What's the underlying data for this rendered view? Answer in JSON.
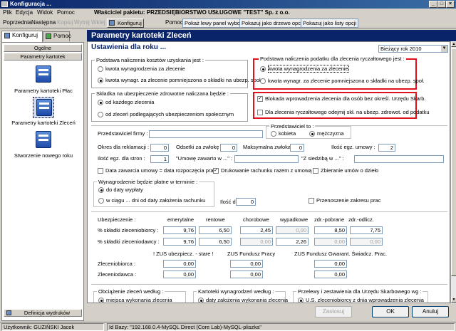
{
  "window": {
    "title": "Konfiguracja ..."
  },
  "menu": [
    "Plik",
    "Edycja",
    "Widok",
    "Pomoc"
  ],
  "owner": "Właściciel pakietu: PRZEDSIĘBIORSTWO USŁUGOWE \"TEST\" Sp. z o.o.",
  "toolbar": {
    "prev": "Poprzednia",
    "next": "Następna",
    "copy": "Kopiuj",
    "cut": "Wytnij",
    "paste": "Wklej",
    "configure": "Konfiguruj",
    "help": "Pomoc:",
    "show_left": "Pokaż lewy panel wyboru",
    "show_tree": "Pokazuj jako drzewo opcji",
    "show_list": "Pokazuj jako listy opcji"
  },
  "tabs": {
    "configure": "Konfiguruj",
    "help": "Pomoc"
  },
  "left": {
    "general": "Ogólne",
    "params": "Parametry kartotek",
    "items": [
      "Parametry kartoteki Płac",
      "Parametry kartoteki Zleceń",
      "Stworzenie nowego roku"
    ],
    "print_defs": "Definicja wydruków"
  },
  "main": {
    "header": "Parametry kartoteki Zleceń",
    "subheader": "Ustawienia dla roku ...",
    "year": "Bieżący rok 2010",
    "g1": {
      "title": "Podstawa naliczenia kosztów uzyskania jest :",
      "o1": "kwota wynagrodzenia za zlecenie",
      "o2": "kwota wynagr. za zlecenie pomniejszona o składki na ubezp. społ."
    },
    "g2": {
      "title": "Podstawa naliczenia podatku dla zlecenia ryczałtowego jest :",
      "o1": "kwota wynagrodzenia za zlecenie",
      "o2": "kwota wynagr. za zlecenie pomniejszona o składki na ubezp. społ."
    },
    "g3": {
      "title": "Składka na ubezpieczenie zdrowotne naliczana będzie :",
      "o1": "od każdego zlecenia",
      "o2": "od zleceń podlegających ubezpieczeniom społecznym"
    },
    "g4": {
      "c1": "Blokada wprowadzenia zlecenia dla osób bez określ. Urzędu Skarb.",
      "c2": "Dla zlecenia ryczałtowego odejmij skł. na ubezp. zdrowot. od podatku"
    },
    "rep": {
      "label": "Przedstawiciel firmy :",
      "value": "",
      "title": "Przedstawiciel to :",
      "f": "kobieta",
      "m": "mężczyzna"
    },
    "row1": {
      "l1": "Okres dla reklamacji :",
      "v1": "0",
      "l2": "Odsetki za zwłokę :",
      "v2": "0",
      "l3": "Maksymalna zwłoka :",
      "v3": "0",
      "l4": "Ilość egz. umowy :",
      "v4": "2"
    },
    "row2": {
      "l1": "Ilość egz. dla stron :",
      "v1": "1",
      "l2": "\"Umowę zawarto w ...\" :",
      "v2": "",
      "l3": "\"Z siedzibą w ...\" :",
      "v3": ""
    },
    "row3": {
      "c1": "Data zawarcia umowy = data rozpoczęcia prac",
      "c2": "Drukowanie rachunku razem z umową",
      "c3": "Zbieranie umów o dzieło"
    },
    "pay": {
      "title": "Wynagrodzenie będzie płatne w terminie :",
      "o1": "do daty wypłaty",
      "o2": "w ciągu ... dni od daty założenia rachunku",
      "days_label": "Ilość dni :",
      "days": "0",
      "transfer": "Przenoszenie zakresu prac"
    },
    "ins": {
      "title": "Ubezpieczenie :",
      "cols": [
        "emerytalne",
        "rentowe",
        "chorobowe",
        "wypadkowe",
        "zdr.-pobrane",
        "zdr.-odlicz."
      ],
      "r1": {
        "label": "% składki zleceniobiorcy :",
        "vals": [
          "9,76",
          "6,50",
          "2,45",
          "0,00",
          "8,50",
          "7,75"
        ]
      },
      "r2": {
        "label": "% składki zleceniodawcy :",
        "vals": [
          "9,76",
          "6,50",
          "0,00",
          "2,26",
          "0,00",
          "0,00"
        ]
      }
    },
    "zus": {
      "cols": [
        "! ZUS ubezpiecz. - stare !",
        "ZUS Fundusz Pracy",
        "ZUS Fundusz Gwarant. Świadcz. Prac."
      ],
      "r1": {
        "label": "Zleceniobiorca :",
        "vals": [
          "0,00",
          "0,00",
          "0,00"
        ]
      },
      "r2": {
        "label": "Zleceniodawca :",
        "vals": [
          "0,00",
          "0,00",
          "0,00"
        ]
      }
    },
    "b1": {
      "title": "Obciążenie zleceń według :",
      "o1": "miejsca wykonania zlecenia"
    },
    "b2": {
      "title": "Kartoteki wynagrodzeń według :",
      "o1": "daty założenia wykonania zlecenia"
    },
    "b3": {
      "title": "Przelewy i zestawienia dla Urzędu Skarbowego wg :",
      "o1": "U.S. zleceniobiorcy z dnia wprowadzenia zlecenia"
    }
  },
  "buttons": {
    "save": "Zastosuj",
    "ok": "OK",
    "cancel": "Anuluj"
  },
  "status": {
    "user": "Użytkownik: GUZIŃSKI Jacek",
    "db": "Id Bazy: \"192.168.0.4-MySQL Direct (Core Lab)-MySQL-pliszka\""
  }
}
